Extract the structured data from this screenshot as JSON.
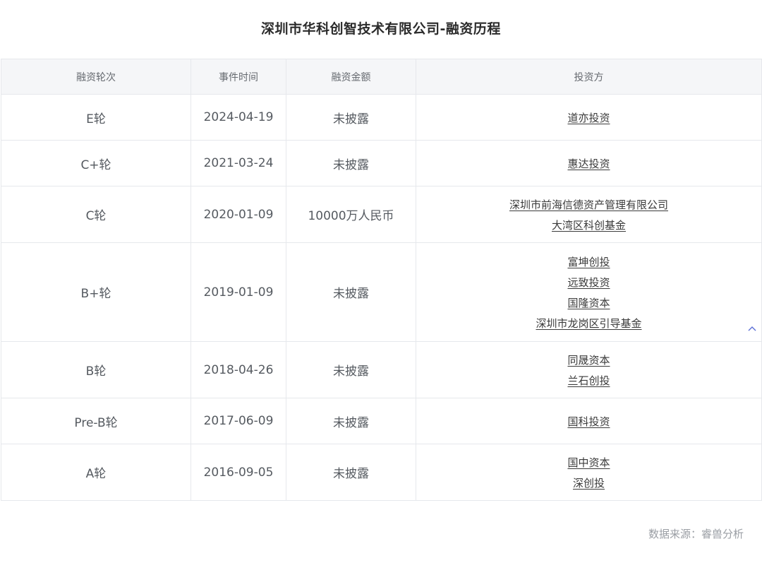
{
  "title": "深圳市华科创智技术有限公司-融资历程",
  "columns": [
    "融资轮次",
    "事件时间",
    "融资金额",
    "投资方"
  ],
  "rows": [
    {
      "round": "E轮",
      "date": "2024-04-19",
      "amount": "未披露",
      "investors": [
        "道亦投资"
      ]
    },
    {
      "round": "C+轮",
      "date": "2021-03-24",
      "amount": "未披露",
      "investors": [
        "惠达投资"
      ]
    },
    {
      "round": "C轮",
      "date": "2020-01-09",
      "amount": "10000万人民币",
      "investors": [
        "深圳市前海信德资产管理有限公司",
        "大湾区科创基金"
      ]
    },
    {
      "round": "B+轮",
      "date": "2019-01-09",
      "amount": "未披露",
      "investors": [
        "富坤创投",
        "远致投资",
        "国隆资本",
        "深圳市龙岗区引导基金"
      ]
    },
    {
      "round": "B轮",
      "date": "2018-04-26",
      "amount": "未披露",
      "investors": [
        "同晟资本",
        "兰石创投"
      ]
    },
    {
      "round": "Pre-B轮",
      "date": "2017-06-09",
      "amount": "未披露",
      "investors": [
        "国科投资"
      ]
    },
    {
      "round": "A轮",
      "date": "2016-09-05",
      "amount": "未披露",
      "investors": [
        "国中资本",
        "深创投"
      ]
    }
  ],
  "source": "数据来源：睿兽分析",
  "icons": {
    "scroll_up": "chevron-up-icon"
  },
  "colors": {
    "accent": "#5b6fd6",
    "header_bg": "#f5f6f8",
    "border": "#e6e8ec"
  }
}
